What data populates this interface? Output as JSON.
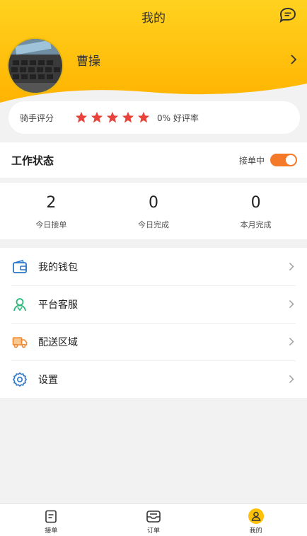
{
  "header": {
    "title": "我的",
    "username": "曹操"
  },
  "rating": {
    "label": "骑手评分",
    "stars": 5,
    "rate_text": "0% 好评率"
  },
  "work": {
    "title": "工作状态",
    "status_label": "接单中",
    "toggle_on": true
  },
  "stats": [
    {
      "value": "2",
      "label": "今日接单"
    },
    {
      "value": "0",
      "label": "今日完成"
    },
    {
      "value": "0",
      "label": "本月完成"
    }
  ],
  "menu": [
    {
      "label": "我的钱包",
      "icon": "wallet-icon"
    },
    {
      "label": "平台客服",
      "icon": "service-icon"
    },
    {
      "label": "配送区域",
      "icon": "delivery-truck-icon"
    },
    {
      "label": "设置",
      "icon": "settings-gear-icon"
    }
  ],
  "tabs": [
    {
      "label": "接单",
      "icon": "clipboard-icon"
    },
    {
      "label": "订单",
      "icon": "order-box-icon"
    },
    {
      "label": "我的",
      "icon": "user-icon",
      "active": true
    }
  ],
  "colors": {
    "brand_yellow": "#ffc107",
    "toggle_orange": "#f47a2a",
    "star_red": "#e8433a",
    "icon_blue": "#2b77c8",
    "icon_green": "#2fb87b",
    "icon_orange": "#f0882e"
  }
}
